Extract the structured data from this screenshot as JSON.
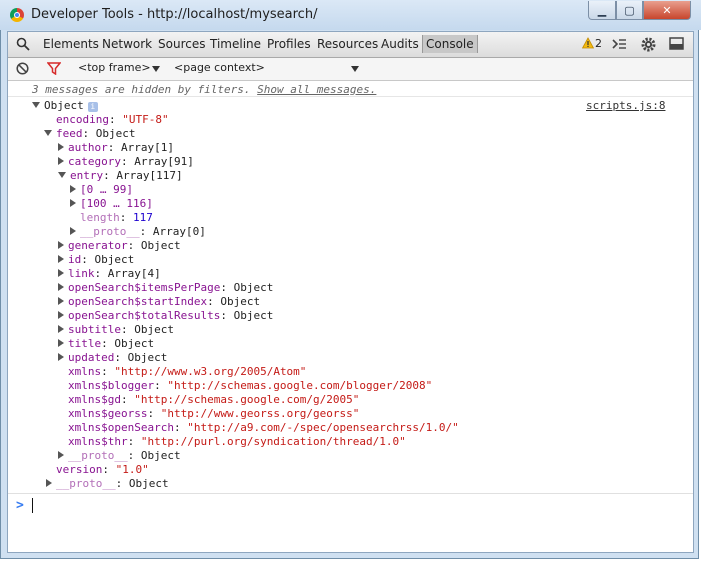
{
  "window": {
    "title": "Developer Tools - http://localhost/mysearch/"
  },
  "toolbar": {
    "tabs": [
      "Elements",
      "Network",
      "Sources",
      "Timeline",
      "Profiles",
      "Resources",
      "Audits",
      "Console"
    ],
    "active_tab": "Console",
    "warning_count": "2"
  },
  "filterbar": {
    "frame_select": "<top frame>",
    "context_select": "<page context>"
  },
  "console": {
    "hidden_prefix": "3 messages are hidden by filters.",
    "hidden_link": "Show all messages.",
    "source_link": "scripts.js:8",
    "lines": [
      {
        "key": "Object",
        "val": "",
        "type": "root"
      },
      {
        "key": "encoding",
        "val": "\"UTF-8\"",
        "type": "str"
      },
      {
        "key": "feed",
        "val": "Object",
        "type": "obj"
      },
      {
        "key": "author",
        "val": "Array[1]",
        "type": "obj"
      },
      {
        "key": "category",
        "val": "Array[91]",
        "type": "obj"
      },
      {
        "key": "entry",
        "val": "Array[117]",
        "type": "obj"
      },
      {
        "key": "[0 … 99]",
        "val": "",
        "type": "range"
      },
      {
        "key": "[100 … 116]",
        "val": "",
        "type": "range"
      },
      {
        "key": "length",
        "val": "117",
        "type": "num"
      },
      {
        "key": "__proto__",
        "val": "Array[0]",
        "type": "proto"
      },
      {
        "key": "generator",
        "val": "Object",
        "type": "obj"
      },
      {
        "key": "id",
        "val": "Object",
        "type": "obj"
      },
      {
        "key": "link",
        "val": "Array[4]",
        "type": "obj"
      },
      {
        "key": "openSearch$itemsPerPage",
        "val": "Object",
        "type": "obj"
      },
      {
        "key": "openSearch$startIndex",
        "val": "Object",
        "type": "obj"
      },
      {
        "key": "openSearch$totalResults",
        "val": "Object",
        "type": "obj"
      },
      {
        "key": "subtitle",
        "val": "Object",
        "type": "obj"
      },
      {
        "key": "title",
        "val": "Object",
        "type": "obj"
      },
      {
        "key": "updated",
        "val": "Object",
        "type": "obj"
      },
      {
        "key": "xmlns",
        "val": "\"http://www.w3.org/2005/Atom\"",
        "type": "str"
      },
      {
        "key": "xmlns$blogger",
        "val": "\"http://schemas.google.com/blogger/2008\"",
        "type": "str"
      },
      {
        "key": "xmlns$gd",
        "val": "\"http://schemas.google.com/g/2005\"",
        "type": "str"
      },
      {
        "key": "xmlns$georss",
        "val": "\"http://www.georss.org/georss\"",
        "type": "str"
      },
      {
        "key": "xmlns$openSearch",
        "val": "\"http://a9.com/-/spec/opensearchrss/1.0/\"",
        "type": "str"
      },
      {
        "key": "xmlns$thr",
        "val": "\"http://purl.org/syndication/thread/1.0\"",
        "type": "str"
      },
      {
        "key": "__proto__",
        "val": "Object",
        "type": "proto"
      },
      {
        "key": "version",
        "val": "\"1.0\"",
        "type": "str"
      },
      {
        "key": "__proto__",
        "val": "Object",
        "type": "proto"
      }
    ]
  }
}
